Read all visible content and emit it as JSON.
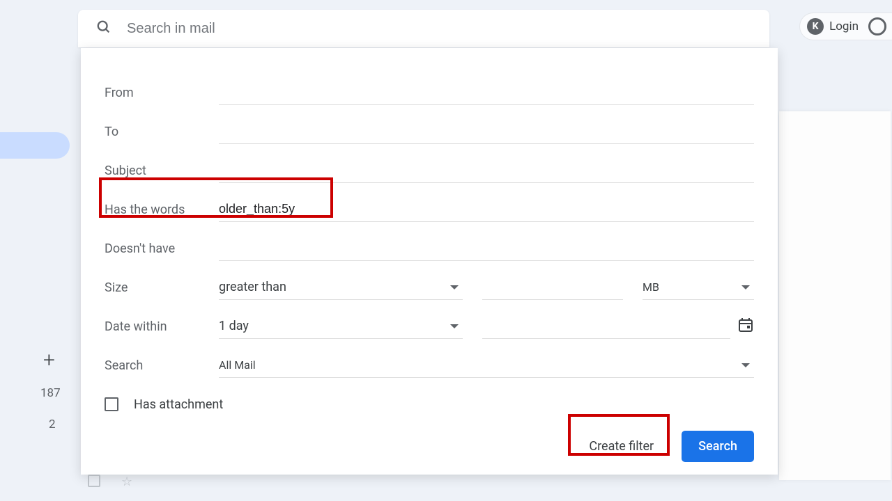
{
  "search": {
    "placeholder": "Search in mail"
  },
  "topright": {
    "login": "Login",
    "badge": "K"
  },
  "sidebar": {
    "count1": "187",
    "count2": "2"
  },
  "filter": {
    "from_label": "From",
    "to_label": "To",
    "subject_label": "Subject",
    "has_words_label": "Has the words",
    "has_words_value": "older_than:5y",
    "doesnt_have_label": "Doesn't have",
    "size_label": "Size",
    "size_op": "greater than",
    "size_unit": "MB",
    "date_label": "Date within",
    "date_value": "1 day",
    "search_label": "Search",
    "search_value": "All Mail",
    "has_attachment_label": "Has attachment",
    "create_filter_label": "Create filter",
    "search_button_label": "Search"
  }
}
